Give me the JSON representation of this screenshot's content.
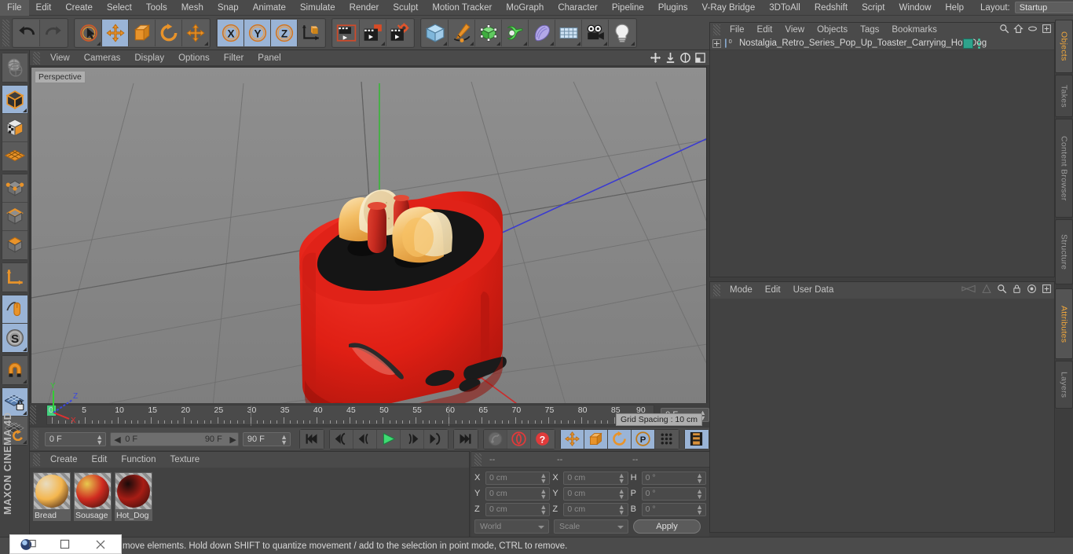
{
  "app": {
    "name": "Cinema 4D",
    "vendor": "MAXON",
    "accent": "#f0a73c",
    "panel_bg": "#424242",
    "selected_tool_bg": "#9ab4d6"
  },
  "menubar": {
    "items": [
      "File",
      "Edit",
      "Create",
      "Select",
      "Tools",
      "Mesh",
      "Snap",
      "Animate",
      "Simulate",
      "Render",
      "Sculpt",
      "Motion Tracker",
      "MoGraph",
      "Character",
      "Pipeline",
      "Plugins",
      "V-Ray Bridge",
      "3DToAll",
      "Redshift",
      "Script",
      "Window",
      "Help"
    ],
    "layout_label": "Layout:",
    "layout_value": "Startup",
    "search_icon": "search-icon"
  },
  "toolbar": {
    "groups": [
      {
        "name": "history",
        "buttons": [
          {
            "icon": "undo-icon",
            "label": "Undo",
            "selected": false,
            "disabled": false,
            "corner": false
          },
          {
            "icon": "redo-icon",
            "label": "Redo",
            "selected": false,
            "disabled": true,
            "corner": false
          }
        ]
      },
      {
        "name": "transform",
        "buttons": [
          {
            "icon": "select-cursor-icon",
            "label": "Live Selection",
            "selected": false,
            "disabled": false,
            "corner": true
          },
          {
            "icon": "move-icon",
            "label": "Move",
            "selected": true,
            "disabled": false,
            "corner": false
          },
          {
            "icon": "scale-icon",
            "label": "Scale",
            "selected": false,
            "disabled": false,
            "corner": false
          },
          {
            "icon": "rotate-icon",
            "label": "Rotate",
            "selected": false,
            "disabled": false,
            "corner": false
          },
          {
            "icon": "move-axis-icon",
            "label": "Move Axis",
            "selected": false,
            "disabled": false,
            "corner": true
          }
        ]
      },
      {
        "name": "axis-lock",
        "buttons": [
          {
            "icon": "axis-x-icon",
            "label": "X",
            "selected": true,
            "disabled": false,
            "corner": false
          },
          {
            "icon": "axis-y-icon",
            "label": "Y",
            "selected": true,
            "disabled": false,
            "corner": false
          },
          {
            "icon": "axis-z-icon",
            "label": "Z",
            "selected": true,
            "disabled": false,
            "corner": false
          },
          {
            "icon": "world-coord-icon",
            "label": "World Coordinate System",
            "selected": false,
            "disabled": false,
            "corner": false
          }
        ]
      },
      {
        "name": "render",
        "buttons": [
          {
            "icon": "render-view-icon",
            "label": "Render View",
            "selected": false,
            "disabled": false,
            "corner": false
          },
          {
            "icon": "render-picture-viewer-icon",
            "label": "Render to Picture Viewer",
            "selected": false,
            "disabled": false,
            "corner": true
          },
          {
            "icon": "render-settings-icon",
            "label": "Edit Render Settings",
            "selected": false,
            "disabled": false,
            "corner": false
          }
        ]
      },
      {
        "name": "create",
        "buttons": [
          {
            "icon": "cube-primitive-icon",
            "label": "Add Cube Object",
            "selected": false,
            "disabled": false,
            "corner": true
          },
          {
            "icon": "pen-spline-icon",
            "label": "Add Spline Object",
            "selected": false,
            "disabled": false,
            "corner": true
          },
          {
            "icon": "generator-icon",
            "label": "Add Generator",
            "selected": false,
            "disabled": false,
            "corner": true
          },
          {
            "icon": "deformer-icon",
            "label": "Add Deformer",
            "selected": false,
            "disabled": false,
            "corner": true
          },
          {
            "icon": "scene-object-icon",
            "label": "Add Scene Object",
            "selected": false,
            "disabled": false,
            "corner": true
          },
          {
            "icon": "floor-icon",
            "label": "Add Environment",
            "selected": false,
            "disabled": false,
            "corner": true
          },
          {
            "icon": "camera-icon",
            "label": "Add Camera",
            "selected": false,
            "disabled": false,
            "corner": true
          },
          {
            "icon": "light-icon",
            "label": "Add Light",
            "selected": false,
            "disabled": false,
            "corner": true
          }
        ]
      }
    ]
  },
  "left_toolbar": {
    "groups": [
      {
        "name": "undo-view",
        "buttons": [
          {
            "icon": "undo-view-icon",
            "label": "Undo View",
            "selected": false,
            "corner": false
          }
        ]
      },
      {
        "name": "modes",
        "buttons": [
          {
            "icon": "model-mode-icon",
            "label": "Model Mode",
            "selected": true,
            "corner": true
          },
          {
            "icon": "texture-mode-icon",
            "label": "Texture Mode",
            "selected": false,
            "corner": false
          },
          {
            "icon": "workplane-mode-icon",
            "label": "Workplane Mode",
            "selected": false,
            "corner": false
          }
        ]
      },
      {
        "name": "components",
        "buttons": [
          {
            "icon": "points-mode-icon",
            "label": "Points Mode",
            "selected": false,
            "corner": false
          },
          {
            "icon": "edges-mode-icon",
            "label": "Edges Mode",
            "selected": false,
            "corner": false
          },
          {
            "icon": "polygons-mode-icon",
            "label": "Polygons Mode",
            "selected": false,
            "corner": false
          }
        ]
      },
      {
        "name": "axis",
        "buttons": [
          {
            "icon": "object-axis-icon",
            "label": "Enable Axis Modification",
            "selected": false,
            "corner": false
          }
        ]
      },
      {
        "name": "viewport-input",
        "buttons": [
          {
            "icon": "viewport-solo-icon",
            "label": "Enable Viewport Solo",
            "selected": true,
            "corner": false
          },
          {
            "icon": "snap-s-icon",
            "label": "Enable Snapping",
            "selected": true,
            "corner": true
          }
        ]
      },
      {
        "name": "magnet",
        "buttons": [
          {
            "icon": "magnet-icon",
            "label": "Magnet Tool",
            "selected": false,
            "corner": true
          }
        ]
      },
      {
        "name": "workplane",
        "buttons": [
          {
            "icon": "workplane-lock-icon",
            "label": "Lock Workplane",
            "selected": true,
            "corner": true
          },
          {
            "icon": "workplane-align-icon",
            "label": "Align Workplane to Selection",
            "selected": false,
            "corner": true
          }
        ]
      }
    ]
  },
  "viewport": {
    "menu": [
      "View",
      "Cameras",
      "Display",
      "Options",
      "Filter",
      "Panel"
    ],
    "header_icons": [
      "pan-icon",
      "dolly-icon",
      "rotate-view-icon",
      "maximize-view-icon"
    ],
    "perspective_label": "Perspective",
    "grid_spacing": "Grid Spacing : 10 cm",
    "axis_gizmo": {
      "x": "X",
      "y": "Y",
      "z": "Z",
      "x_color": "#d23a3a",
      "y_color": "#3ac93a",
      "z_color": "#3a56d2"
    },
    "model": {
      "name": "Pop-Up Toaster with Hot Dog",
      "body_color": "#e01e14",
      "slot_color": "#141414",
      "bread_color": "#f0b856",
      "sausage_color": "#c22b22"
    },
    "background_color": "#878787"
  },
  "timeline": {
    "ruler_start": 0,
    "ruler_end": 90,
    "tick_labels": [
      0,
      5,
      10,
      15,
      20,
      25,
      30,
      35,
      40,
      45,
      50,
      55,
      60,
      65,
      70,
      75,
      80,
      85,
      90
    ],
    "current_frame_field": "0 F",
    "playhead_frame": 0
  },
  "transport": {
    "frame_field": "0 F",
    "range_start": "0 F",
    "range_end": "90 F",
    "max_frame_field": "90 F",
    "buttons": [
      {
        "icon": "go-to-start-icon",
        "label": "Go to Start",
        "selected": false,
        "disabled": false
      },
      {
        "icon": "step-back-keyframe-icon",
        "label": "Go to Previous Key",
        "selected": false,
        "disabled": false
      },
      {
        "icon": "step-back-frame-icon",
        "label": "Go to Previous Frame",
        "selected": false,
        "disabled": false
      },
      {
        "icon": "play-icon",
        "label": "Play Forwards",
        "selected": false,
        "disabled": false
      },
      {
        "icon": "step-forward-frame-icon",
        "label": "Go to Next Frame",
        "selected": false,
        "disabled": false
      },
      {
        "icon": "step-forward-keyframe-icon",
        "label": "Go to Next Key",
        "selected": false,
        "disabled": false
      },
      {
        "icon": "go-to-end-icon",
        "label": "Go to End",
        "selected": false,
        "disabled": false
      },
      {
        "icon": "record-active-objects-icon",
        "label": "Record Active Objects",
        "selected": false,
        "disabled": true
      },
      {
        "icon": "autokeying-icon",
        "label": "Autokeying",
        "selected": false,
        "disabled": false
      },
      {
        "icon": "keyframe-selection-icon",
        "label": "Keyframe Selection",
        "selected": false,
        "disabled": false
      },
      {
        "icon": "position-key-icon",
        "label": "Position",
        "selected": true,
        "disabled": false
      },
      {
        "icon": "scale-key-icon",
        "label": "Scale",
        "selected": true,
        "disabled": false
      },
      {
        "icon": "rotation-key-icon",
        "label": "Rotation",
        "selected": true,
        "disabled": false
      },
      {
        "icon": "param-key-icon",
        "label": "Parameter",
        "selected": true,
        "disabled": false
      },
      {
        "icon": "point-level-animation-icon",
        "label": "Point Level Animation",
        "selected": false,
        "disabled": false
      },
      {
        "icon": "timeline-icon",
        "label": "Timeline",
        "selected": true,
        "disabled": false
      }
    ]
  },
  "materials": {
    "menu": [
      "Create",
      "Edit",
      "Function",
      "Texture"
    ],
    "items": [
      {
        "name": "Bread",
        "color_a": "#f4b64e",
        "color_b": "#e8dcc0",
        "selected": false
      },
      {
        "name": "Sousage",
        "color_a": "#cf2b20",
        "color_b": "#e8c94e",
        "selected": false
      },
      {
        "name": "Hot_Dog",
        "color_a": "#a81d15",
        "color_b": "#1a0b0a",
        "selected": false
      }
    ]
  },
  "coordinates": {
    "col_headers": [
      "--",
      "--",
      "--"
    ],
    "rows": [
      {
        "lbl_pos": "X",
        "val_pos": "0 cm",
        "lbl_size": "X",
        "val_size": "0 cm",
        "lbl_rot": "H",
        "val_rot": "0 °"
      },
      {
        "lbl_pos": "Y",
        "val_pos": "0 cm",
        "lbl_size": "Y",
        "val_size": "0 cm",
        "lbl_rot": "P",
        "val_rot": "0 °"
      },
      {
        "lbl_pos": "Z",
        "val_pos": "0 cm",
        "lbl_size": "Z",
        "val_size": "0 cm",
        "lbl_rot": "B",
        "val_rot": "0 °"
      }
    ],
    "system_value": "World",
    "mode_value": "Scale",
    "apply_label": "Apply"
  },
  "object_manager": {
    "menu": [
      "File",
      "Edit",
      "View",
      "Objects",
      "Tags",
      "Bookmarks"
    ],
    "header_icons": [
      "search-icon",
      "home-icon",
      "ellipse-icon",
      "add-layer-icon"
    ],
    "objects": [
      {
        "name": "Nostalgia_Retro_Series_Pop_Up_Toaster_Carrying_Hot_Dog",
        "level_badge": "0",
        "expandable": true,
        "tag_color": "#2fa38c"
      }
    ]
  },
  "attributes": {
    "menu": [
      "Mode",
      "Edit",
      "User Data"
    ],
    "header_icons": [
      "history-back-icon",
      "pin-icon",
      "search-icon",
      "lock-icon",
      "target-icon",
      "add-tab-icon"
    ]
  },
  "right_tabs": {
    "top": [
      {
        "label": "Objects",
        "active": true
      },
      {
        "label": "Takes",
        "active": false
      },
      {
        "label": "Content Browser",
        "active": false
      },
      {
        "label": "Structure",
        "active": false
      }
    ],
    "bottom": [
      {
        "label": "Attributes",
        "active": true
      },
      {
        "label": "Layers",
        "active": false
      }
    ]
  },
  "statusbar": {
    "message": "move elements. Hold down SHIFT to quantize movement / add to the selection in point mode, CTRL to remove.",
    "window_controls": [
      "app-icon",
      "minimize-icon",
      "close-icon"
    ]
  }
}
